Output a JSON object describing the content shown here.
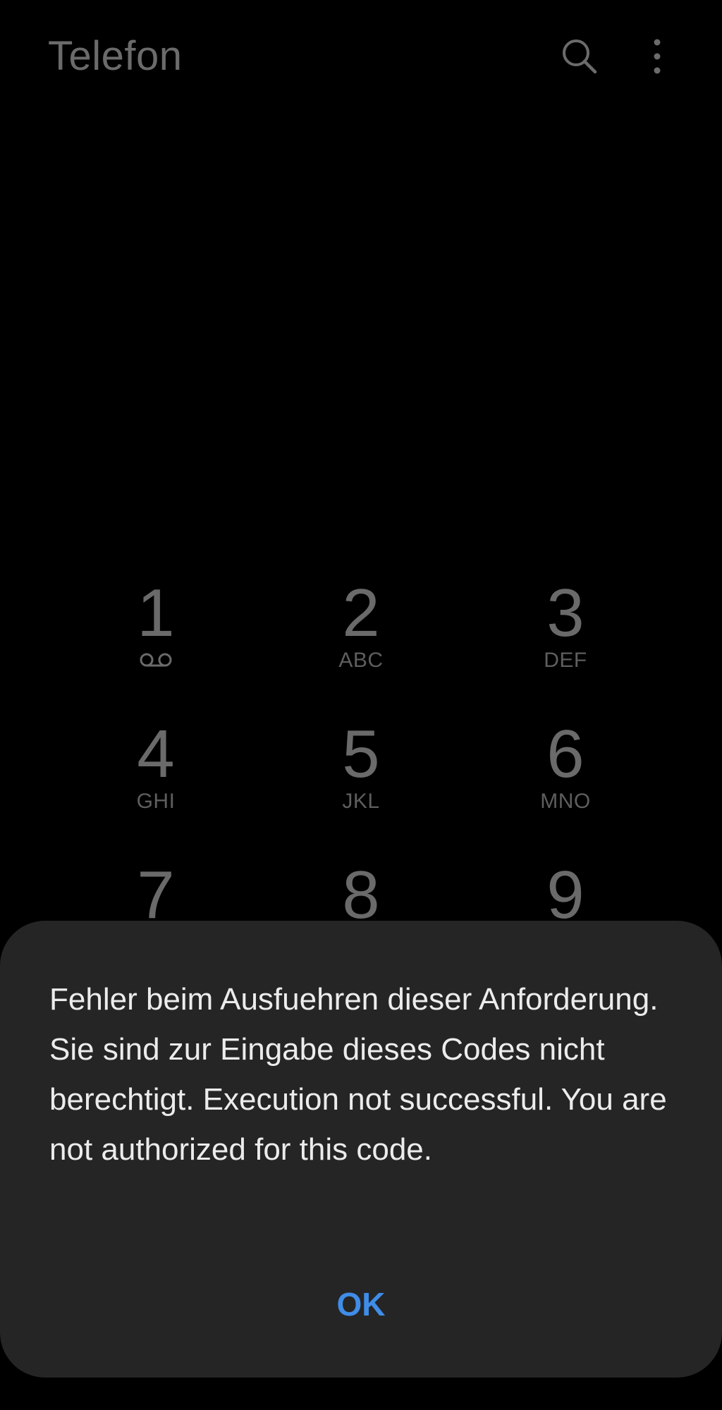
{
  "header": {
    "title": "Telefon",
    "icons": [
      "search-icon",
      "more-options-icon"
    ]
  },
  "keypad": {
    "keys": [
      {
        "digit": "1",
        "letters": "",
        "icon": "voicemail-icon"
      },
      {
        "digit": "2",
        "letters": "ABC"
      },
      {
        "digit": "3",
        "letters": "DEF"
      },
      {
        "digit": "4",
        "letters": "GHI"
      },
      {
        "digit": "5",
        "letters": "JKL"
      },
      {
        "digit": "6",
        "letters": "MNO"
      },
      {
        "digit": "7",
        "letters": ""
      },
      {
        "digit": "8",
        "letters": ""
      },
      {
        "digit": "9",
        "letters": ""
      }
    ]
  },
  "dialog": {
    "message": "Fehler beim Ausfuehren dieser Anforderung. Sie sind zur Eingabe dieses Codes nicht berechtigt. Execution not successful. You are not authorized for this code.",
    "ok_label": "OK"
  },
  "colors": {
    "background": "#000000",
    "dialog_background": "#252525",
    "accent": "#3f8de8",
    "dim_text": "#6b6b6b"
  }
}
